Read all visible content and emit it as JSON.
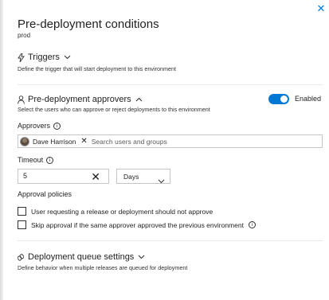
{
  "panel": {
    "title": "Pre-deployment conditions",
    "subtitle": "prod",
    "close_glyph": "✕"
  },
  "triggers": {
    "label": "Triggers",
    "description": "Define the trigger that will start deployment to this environment",
    "icon": "lightning-icon"
  },
  "approvers_section": {
    "label": "Pre-deployment approvers",
    "description": "Select the users who can approve or reject deployments to this environment",
    "toggle_label": "Enabled",
    "toggle_on": true,
    "accent_color": "#0078d4",
    "approvers_label": "Approvers",
    "approvers": [
      {
        "name": "Dave Harrison"
      }
    ],
    "search_placeholder": "Search users and groups",
    "timeout_label": "Timeout",
    "timeout_value": "5",
    "timeout_unit": "Days",
    "approval_policies_label": "Approval policies",
    "policies": [
      {
        "label": "User requesting a release or deployment should not approve",
        "checked": false,
        "has_info": false
      },
      {
        "label": "Skip approval if the same approver approved the previous environment",
        "checked": false,
        "has_info": true
      }
    ]
  },
  "queue_settings": {
    "label": "Deployment queue settings",
    "description": "Define behavior when multiple releases are queued for deployment"
  }
}
